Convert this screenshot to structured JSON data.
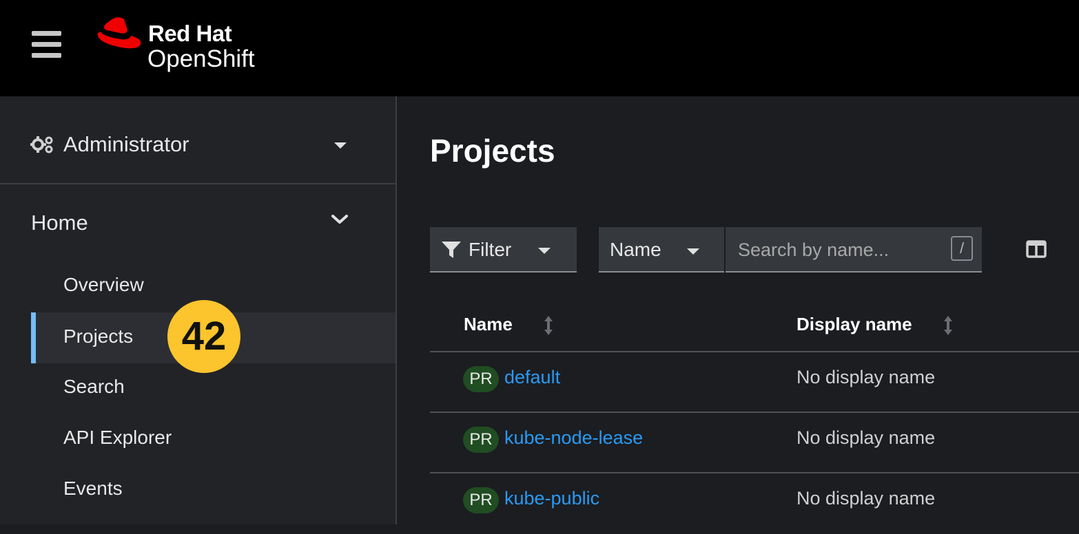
{
  "masthead": {
    "brand_line1": "Red Hat",
    "brand_line2": "OpenShift",
    "brand_color": "#ee0000"
  },
  "sidebar": {
    "perspective_label": "Administrator",
    "section_label": "Home",
    "items": [
      {
        "label": "Overview",
        "active": false
      },
      {
        "label": "Projects",
        "active": true
      },
      {
        "label": "Search",
        "active": false
      },
      {
        "label": "API Explorer",
        "active": false
      },
      {
        "label": "Events",
        "active": false
      }
    ],
    "active_accent": "#73bcf7"
  },
  "overlay_badge": "42",
  "main": {
    "title": "Projects",
    "toolbar": {
      "filter_label": "Filter",
      "attribute_label": "Name",
      "search_placeholder": "Search by name...",
      "shortcut_key": "/"
    },
    "table": {
      "columns": [
        "Name",
        "Display name"
      ],
      "rows": [
        {
          "badge": "PR",
          "name": "default",
          "display_name": "No display name"
        },
        {
          "badge": "PR",
          "name": "kube-node-lease",
          "display_name": "No display name"
        },
        {
          "badge": "PR",
          "name": "kube-public",
          "display_name": "No display name"
        }
      ]
    },
    "link_color": "#2b9af3"
  }
}
